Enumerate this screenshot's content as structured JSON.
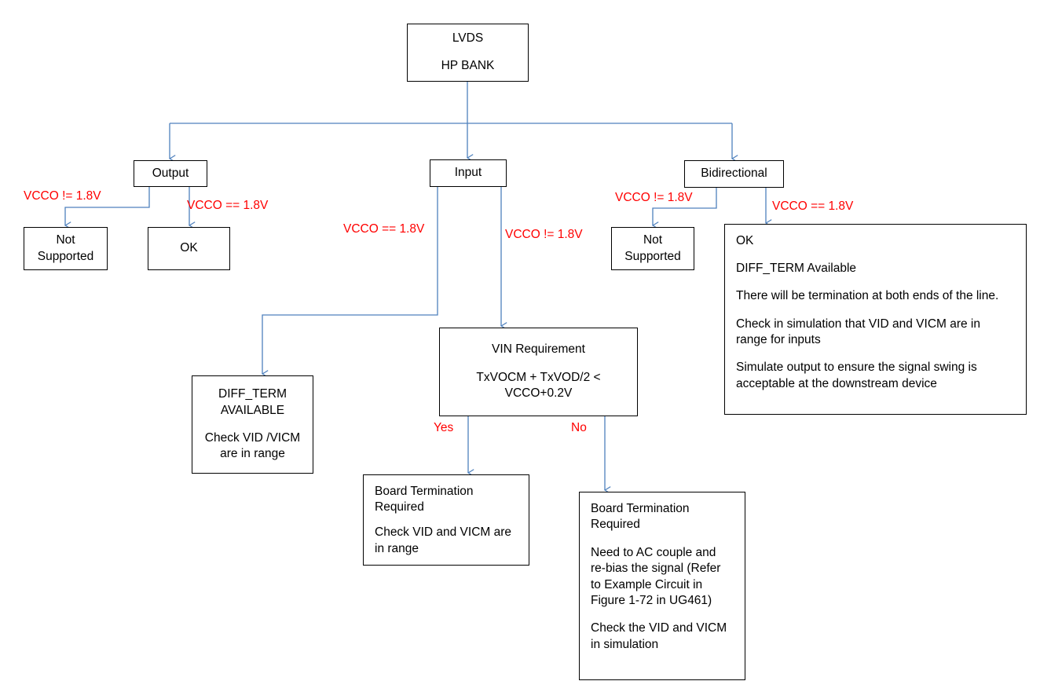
{
  "diagram": {
    "title": "LVDS HP BANK interface decision flowchart",
    "line_color": "#4F81BD",
    "label_color": "#FF0000",
    "box_border_color": "#000000",
    "background": "#FFFFFF"
  },
  "nodes": {
    "root": {
      "line1": "LVDS",
      "line2": "HP BANK"
    },
    "output": {
      "label": "Output"
    },
    "input": {
      "label": "Input"
    },
    "bidirectional": {
      "label": "Bidirectional"
    },
    "output_not_supported": {
      "line1": "Not",
      "line2": "Supported"
    },
    "output_ok": {
      "label": "OK"
    },
    "bidir_not_supported": {
      "line1": "Not",
      "line2": "Supported"
    },
    "bidir_ok": {
      "line1": "OK",
      "line2": "DIFF_TERM Available",
      "line3": "There will be termination at both ends of the line.",
      "line4a": "Check in simulation that VID and VICM are in",
      "line4b": "range for inputs",
      "line5a": "Simulate output to ensure the signal swing is",
      "line5b": "acceptable at the downstream device"
    },
    "diff_term_available": {
      "line1": "DIFF_TERM",
      "line2": "AVAILABLE",
      "line3": "Check VID /VICM",
      "line4": "are in range"
    },
    "vin_requirement": {
      "line1": "VIN Requirement",
      "line2": "TxVOCM + TxVOD/2 <",
      "line3": "VCCO+0.2V"
    },
    "board_term_yes": {
      "line1": "Board Termination",
      "line2": "Required",
      "line3": "Check VID and VICM are",
      "line4": "in range"
    },
    "board_term_no": {
      "line1": "Board Termination",
      "line2": "Required",
      "line3": "Need to AC couple and",
      "line4": "re-bias the signal (Refer",
      "line5": "to Example Circuit in",
      "line6": "Figure 1-72 in UG461)",
      "line7": "Check the VID and VICM",
      "line8": "in simulation"
    }
  },
  "edge_labels": {
    "output_not_eq": "VCCO != 1.8V",
    "output_eq": "VCCO == 1.8V",
    "input_eq": "VCCO == 1.8V",
    "input_not_eq": "VCCO != 1.8V",
    "bidir_not_eq": "VCCO != 1.8V",
    "bidir_eq": "VCCO == 1.8V",
    "vin_yes": "Yes",
    "vin_no": "No"
  }
}
